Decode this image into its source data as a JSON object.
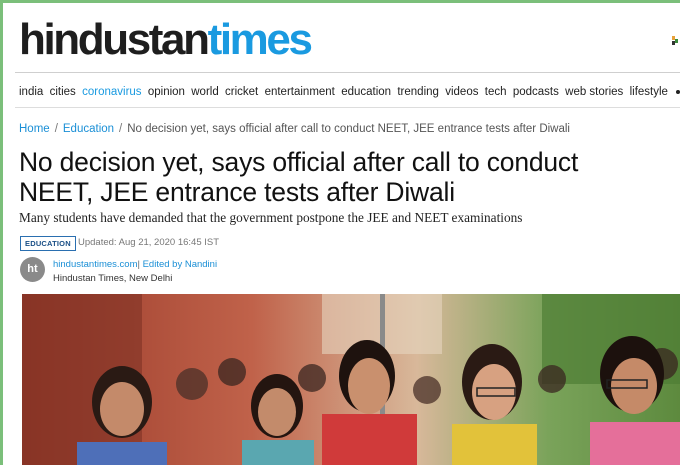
{
  "masthead": {
    "logo_part1": "hindustan",
    "logo_part2": "times"
  },
  "nav": {
    "items": [
      "india",
      "cities",
      "coronavirus",
      "opinion",
      "world",
      "cricket",
      "entertainment",
      "education",
      "trending",
      "videos",
      "tech",
      "podcasts",
      "web stories",
      "lifestyle"
    ],
    "highlighted": "coronavirus"
  },
  "breadcrumb": {
    "home": "Home",
    "section": "Education",
    "current": "No decision yet, says official after call to conduct NEET, JEE entrance tests after Diwali"
  },
  "article": {
    "headline": "No decision yet, says official after call to conduct NEET, JEE entrance tests after Diwali",
    "summary": "Many students have demanded that the government postpone the JEE and NEET examinations",
    "tag": "EDUCATION",
    "updated": "Updated: Aug 21, 2020 16:45 IST",
    "avatar_text": "ht",
    "source": "hindustantimes.com",
    "editor": "Edited by Nandini",
    "dateline": "Hindustan Times, New Delhi"
  },
  "colors": {
    "brand_blue": "#1a9ae0",
    "brand_dark": "#1e1e1e",
    "accent_green": "#7bbf7a"
  }
}
